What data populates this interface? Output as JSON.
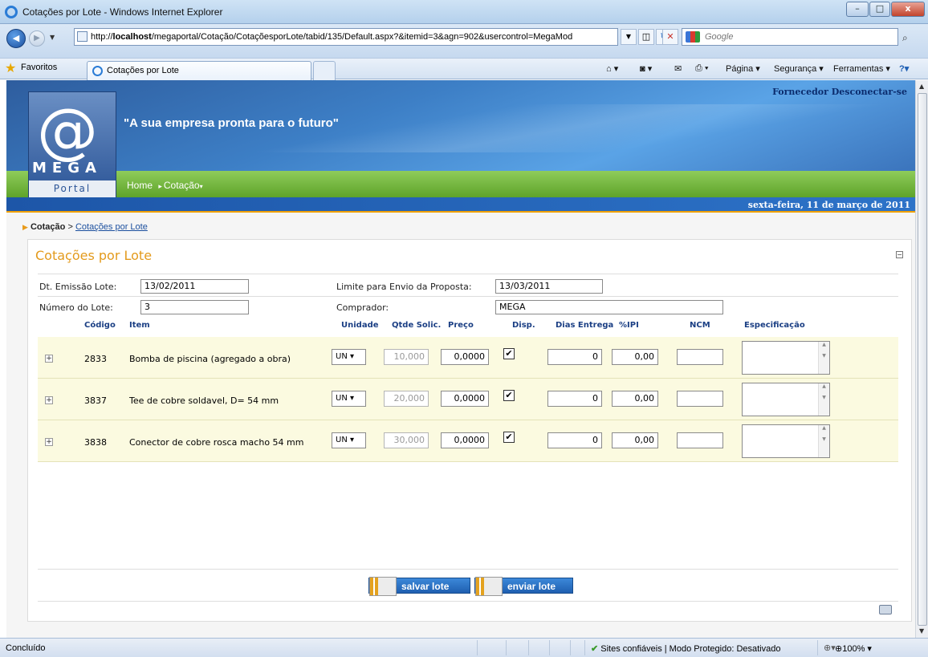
{
  "window": {
    "title": "Cotações por Lote - Windows Internet Explorer",
    "min": "–",
    "max": "□",
    "close": "x"
  },
  "nav": {
    "url_prefix": "http://",
    "url_host": "localhost",
    "url_rest": "/megaportal/Cotação/CotaçõesporLote/tabid/135/Default.aspx?&itemid=3&agn=902&usercontrol=MegaMod",
    "search_placeholder": "Google"
  },
  "favbar": {
    "favoritos": "Favoritos",
    "tab_title": "Cotações por Lote",
    "pagina": "Página ▾",
    "seguranca": "Segurança ▾",
    "ferramentas": "Ferramentas ▾"
  },
  "header": {
    "logo_mega": "MEGA",
    "logo_portal": "Portal",
    "slogan": "\"A sua empresa pronta para o futuro\"",
    "link_fornecedor": "Fornecedor",
    "link_desconectar": "Desconectar-se",
    "menu_home": "Home",
    "menu_cotacao": "Cotação",
    "date": "sexta-feira, 11 de março de 2011"
  },
  "breadcrumb": {
    "root": "Cotação",
    "sep": ">",
    "current": "Cotações por Lote"
  },
  "panel": {
    "title": "Cotações por Lote",
    "dt_emissao_label": "Dt. Emissão Lote:",
    "dt_emissao": "13/02/2011",
    "limite_label": "Limite para Envio da Proposta:",
    "limite": "13/03/2011",
    "numero_label": "Número do Lote:",
    "numero": "3",
    "comprador_label": "Comprador:",
    "comprador": "MEGA"
  },
  "table": {
    "headers": {
      "codigo": "Código",
      "item": "Item",
      "unidade": "Unidade",
      "qtde": "Qtde Solic.",
      "preco": "Preço",
      "disp": "Disp.",
      "dias": "Dias Entrega",
      "ipi": "%IPI",
      "ncm": "NCM",
      "espec": "Especificação"
    },
    "rows": [
      {
        "codigo": "2833",
        "item": "Bomba de piscina (agregado a obra)",
        "unidade": "UN",
        "qtde": "10,000",
        "preco": "0,0000",
        "disp": "✔",
        "dias": "0",
        "ipi": "0,00"
      },
      {
        "codigo": "3837",
        "item": "Tee de cobre soldavel, D= 54 mm",
        "unidade": "UN",
        "qtde": "20,000",
        "preco": "0,0000",
        "disp": "✔",
        "dias": "0",
        "ipi": "0,00"
      },
      {
        "codigo": "3838",
        "item": "Conector de cobre rosca macho 54 mm",
        "unidade": "UN",
        "qtde": "30,000",
        "preco": "0,0000",
        "disp": "✔",
        "dias": "0",
        "ipi": "0,00"
      }
    ]
  },
  "buttons": {
    "salvar": "salvar lote",
    "enviar": "enviar lote"
  },
  "status": {
    "text": "Concluído",
    "zone": "Sites confiáveis | Modo Protegido: Desativado",
    "zoom": "100%"
  }
}
